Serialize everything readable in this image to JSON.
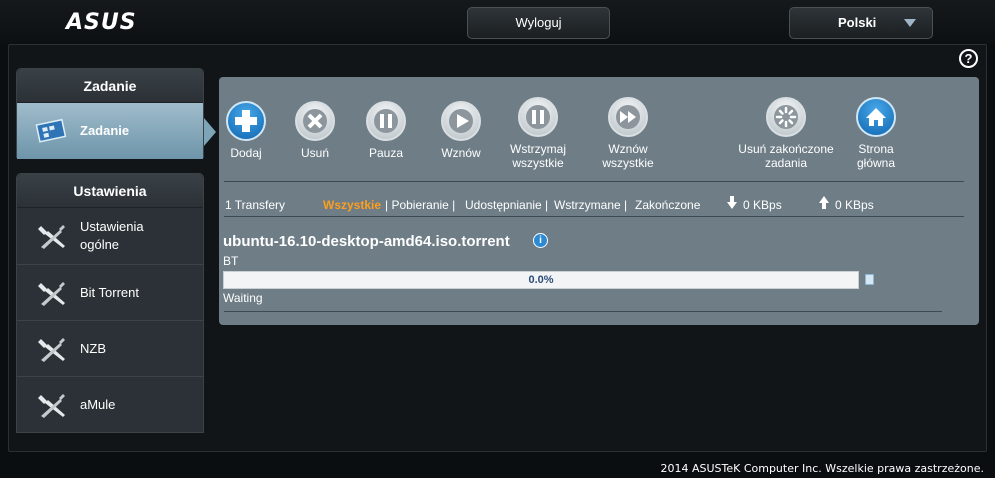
{
  "header": {
    "logo": "ASUS",
    "logout_label": "Wyloguj",
    "language": "Polski"
  },
  "help_symbol": "?",
  "sidebar": {
    "task_section": {
      "title": "Zadanie",
      "items": [
        {
          "label": "Zadanie",
          "icon": "tasks-icon",
          "active": true
        }
      ]
    },
    "settings_section": {
      "title": "Ustawienia",
      "items": [
        {
          "label_line1": "Ustawienia",
          "label_line2": "ogólne",
          "icon": "tools-icon"
        },
        {
          "label": "Bit Torrent",
          "icon": "tools-icon"
        },
        {
          "label": "NZB",
          "icon": "tools-icon"
        },
        {
          "label": "aMule",
          "icon": "tools-icon"
        }
      ]
    }
  },
  "toolbar": {
    "add": "Dodaj",
    "remove": "Usuń",
    "pause": "Pauza",
    "resume": "Wznów",
    "pause_all_line1": "Wstrzymaj",
    "pause_all_line2": "wszystkie",
    "resume_all_line1": "Wznów",
    "resume_all_line2": "wszystkie",
    "clear_completed_line1": "Usuń zakończone",
    "clear_completed_line2": "zadania",
    "home_line1": "Strona",
    "home_line2": "główna"
  },
  "filters": {
    "count": "1 Transfery",
    "all": "Wszystkie",
    "downloading": "| Pobieranie |",
    "seeding": "Udostępnianie |",
    "paused": "Wstrzymane |",
    "finished": "Zakończone",
    "down_speed": "0 KBps",
    "up_speed": "0 KBps"
  },
  "transfer": {
    "name": "ubuntu-16.10-desktop-amd64.iso.torrent",
    "info_symbol": "i",
    "type": "BT",
    "progress_text": "0.0%",
    "progress_fraction": 0.0,
    "status": "Waiting"
  },
  "footer": "2014 ASUSTeK Computer Inc. Wszelkie prawa zastrzeżone.",
  "colors": {
    "active_filter": "#ff9e1c",
    "panel": "#6e7d86",
    "active_sidebar": "#86a9bb"
  }
}
